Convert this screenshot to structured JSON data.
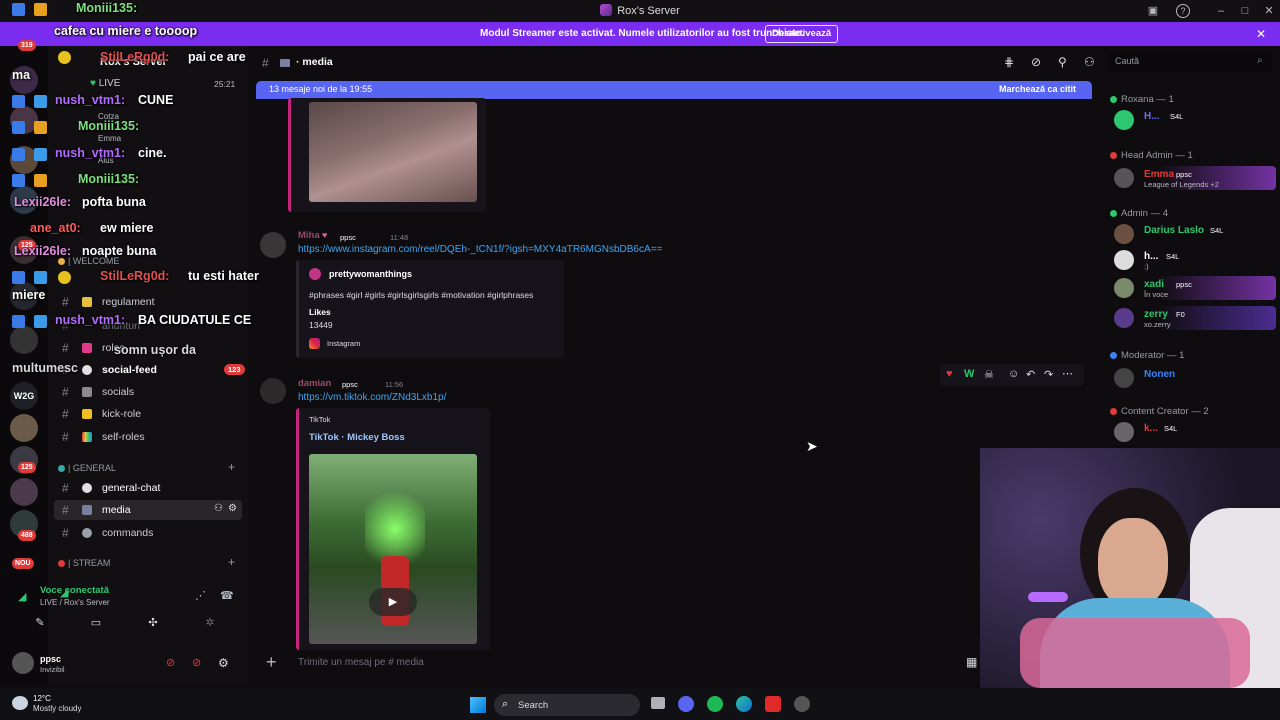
{
  "window": {
    "title": "Rox's Server"
  },
  "banner": {
    "message": "Modul Streamer este activat. Numele utilizatorilor au fost trunchiate.",
    "button": "Dezactivează"
  },
  "rail": {
    "badges": [
      "319",
      "125",
      "125",
      "488",
      "NOU"
    ]
  },
  "sidebar": {
    "server_name": "Rox's Server",
    "live_label": "LIVE",
    "live_time": "25:21",
    "voice_users": [
      "Cotza",
      "Emma",
      "Alus"
    ],
    "categories": {
      "welcome": "| WELCOME",
      "general": "| GENERAL",
      "stream": "| STREAM"
    },
    "channels_welcome": [
      {
        "name": "regulament"
      },
      {
        "name": "anunturi"
      },
      {
        "name": "roles"
      },
      {
        "name": "social-feed",
        "badge": "123"
      },
      {
        "name": "socials"
      },
      {
        "name": "kick-role"
      },
      {
        "name": "self-roles"
      }
    ],
    "channels_general": [
      {
        "name": "general-chat"
      },
      {
        "name": "media"
      },
      {
        "name": "commands"
      }
    ],
    "voice_panel": {
      "status": "Voce conectată",
      "location": "LIVE / Rox's Server"
    },
    "user_panel": {
      "name": "ppsc",
      "status": "Invizibil"
    }
  },
  "channel": {
    "name": "media",
    "search_placeholder": "Caută",
    "new_messages": "13 mesaje noi de la 19:55",
    "mark_read": "Marchează ca citit",
    "composer_placeholder": "Trimite un mesaj pe # media"
  },
  "messages": [
    {
      "author": "Miha",
      "tag": "ppsc",
      "time": "11:48",
      "link": "https://www.instagram.com/reel/DQEh-_tCN1f/?igsh=MXY4aTR6MGNsbDB6cA==",
      "embed": {
        "provider_user": "prettywomanthings",
        "text": "#phrases #girl #girls #girlsgirlsgirls #motivation #girlphrases",
        "likes_label": "Likes",
        "likes": "13449",
        "footer": "Instagram"
      }
    },
    {
      "author": "damian",
      "tag": "ppsc",
      "time": "11:56",
      "link": "https://vm.tiktok.com/ZNd3Lxb1p/",
      "embed": {
        "provider": "TikTok",
        "title": "TikTok · Mickey Boss"
      }
    }
  ],
  "members": {
    "groups": [
      {
        "title": "Roxana — 1",
        "color": "#2dc770",
        "members": [
          {
            "name": "H...",
            "tag": "S4L",
            "color": "#6b6bff"
          }
        ]
      },
      {
        "title": "Head Admin — 1",
        "color": "#e03a3a",
        "members": [
          {
            "name": "Emma",
            "tag": "ppsc",
            "color": "#e03a3a",
            "sub": "League of Legends +2"
          }
        ]
      },
      {
        "title": "Admin — 4",
        "color": "#2dc770",
        "members": [
          {
            "name": "Darius Laslo",
            "tag": "S4L",
            "color": "#2dc770"
          },
          {
            "name": "h...",
            "tag": "S4L",
            "color": "#ffffff",
            "sub": ":)"
          },
          {
            "name": "xadi",
            "tag": "ppsc",
            "color": "#2dc770",
            "sub": "În voce"
          },
          {
            "name": "zerry",
            "tag": "F0",
            "color": "#2dc770",
            "sub": "xo.zerry"
          }
        ]
      },
      {
        "title": "Moderator — 1",
        "color": "#3b82f6",
        "members": [
          {
            "name": "Nonen",
            "tag": "",
            "color": "#3b82f6"
          }
        ]
      },
      {
        "title": "Content Creator — 2",
        "color": "#e03a3a",
        "members": [
          {
            "name": "k...",
            "tag": "S4L",
            "color": "#e03a3a"
          }
        ]
      }
    ]
  },
  "taskbar": {
    "weather_temp": "12°C",
    "weather_desc": "Mostly cloudy",
    "search": "Search"
  },
  "overlay_chat": [
    {
      "user": "Moniii135:",
      "text": "",
      "color": "#7ee07e"
    },
    {
      "user": "",
      "text": "cafea cu miere e toooop",
      "color": "#ffffff"
    },
    {
      "user": "StilLeRg0d:",
      "text": "pai ce are",
      "color": "#e05050"
    },
    {
      "user": "",
      "text": "ma",
      "color": "#ffffff"
    },
    {
      "user": "nush_vtm1:",
      "text": "CUNE",
      "color": "#b46bff"
    },
    {
      "user": "Moniii135:",
      "text": "",
      "color": "#7ee07e"
    },
    {
      "user": "nush_vtm1:",
      "text": "cine.",
      "color": "#b46bff"
    },
    {
      "user": "Moniii135:",
      "text": "",
      "color": "#7ee07e"
    },
    {
      "user": "Lexii26le:",
      "text": "pofta buna",
      "color": "#e58de0"
    },
    {
      "user": "ane_at0:",
      "text": "ew miere",
      "color": "#ff5a5a"
    },
    {
      "user": "Lexii26le:",
      "text": "noapte buna",
      "color": "#e58de0"
    },
    {
      "user": "StilLeRg0d:",
      "text": "tu esti hater",
      "color": "#e05050"
    },
    {
      "user": "",
      "text": "miere",
      "color": "#ffffff"
    },
    {
      "user": "nush_vtm1:",
      "text": "BA CIUDATULE CE",
      "color": "#b46bff"
    },
    {
      "user": "",
      "text": "somn ușor da",
      "color": "#ffffff"
    },
    {
      "user": "",
      "text": "multumesc",
      "color": "#ffffff"
    }
  ]
}
